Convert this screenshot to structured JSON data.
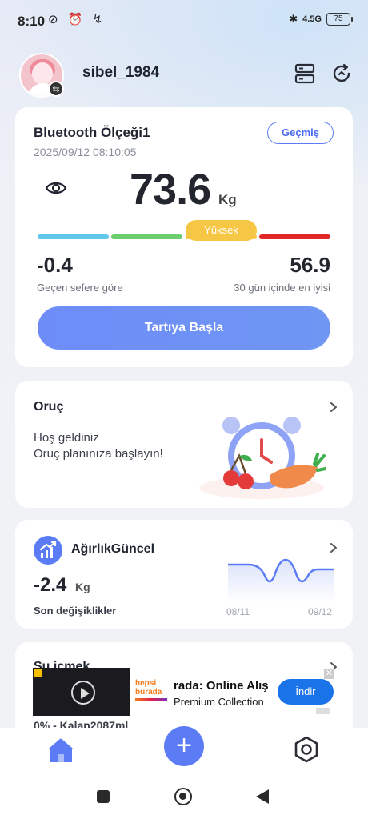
{
  "status_bar": {
    "time": "8:10",
    "left_icons": "⊘ ⏰ ↯",
    "signal_text": "4.5G",
    "battery": "75"
  },
  "header": {
    "username": "sibel_1984"
  },
  "weight_card": {
    "scale_name": "Bluetooth Ölçeği1",
    "datetime": "2025/09/12 08:10:05",
    "history_label": "Geçmiş",
    "weight": "73.6",
    "unit": "Kg",
    "level_label": "Yüksek",
    "level_index": 3,
    "delta_value": "-0.4",
    "delta_label": "Geçen sefere göre",
    "best_value": "56.9",
    "best_label": "30 gün içinde en iyisi",
    "start_button": "Tartıya Başla"
  },
  "fasting_card": {
    "title": "Oruç",
    "line1": "Hoş geldiniz",
    "line2": "Oruç planınıza başlayın!"
  },
  "trend_card": {
    "title": "AğırlıkGüncel",
    "value": "-2.4",
    "unit": "Kg",
    "label": "Son değişiklikler",
    "x_start": "08/11",
    "x_end": "09/12"
  },
  "water_card": {
    "title": "Su içmek",
    "status": "0% - Kalan2087ml"
  },
  "ad": {
    "brand_line1": "hepsi",
    "brand_line2": "burada",
    "title": "rada: Online Alış",
    "subtitle": "Premium Collection",
    "cta": "İndir",
    "close": "✕"
  },
  "bottom_nav": {
    "add_symbol": "+"
  },
  "colors": {
    "accent": "#5b7cf5",
    "underweight": "#5ec7ea",
    "normal": "#6ccd6f",
    "high": "#f6c744",
    "obese": "#e02626"
  }
}
